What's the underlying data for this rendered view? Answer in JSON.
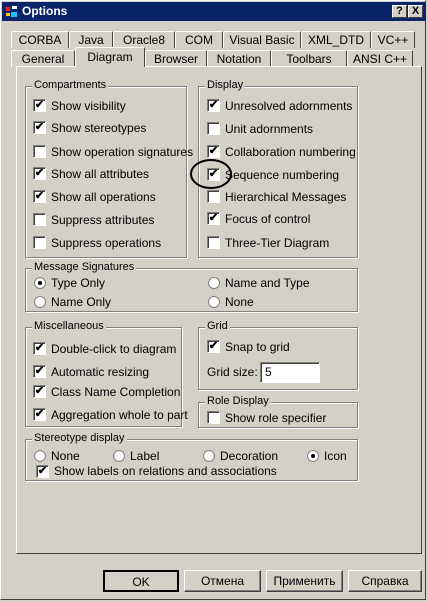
{
  "window": {
    "title": "Options"
  },
  "title_buttons": {
    "help": "?",
    "close": "X"
  },
  "tabs_row1": [
    "CORBA",
    "Java",
    "Oracle8",
    "COM",
    "Visual Basic",
    "XML_DTD",
    "VC++"
  ],
  "tabs_row2": [
    "General",
    "Diagram",
    "Browser",
    "Notation",
    "Toolbars",
    "ANSI C++"
  ],
  "active_tab": "Diagram",
  "compartments": {
    "legend": "Compartments",
    "items": [
      {
        "label": "Show visibility",
        "checked": true
      },
      {
        "label": "Show stereotypes",
        "checked": true
      },
      {
        "label": "Show operation signatures",
        "checked": false
      },
      {
        "label": "Show all attributes",
        "checked": true
      },
      {
        "label": "Show all operations",
        "checked": true
      },
      {
        "label": "Suppress attributes",
        "checked": false
      },
      {
        "label": "Suppress operations",
        "checked": false
      }
    ]
  },
  "display": {
    "legend": "Display",
    "items": [
      {
        "label": "Unresolved adornments",
        "checked": true
      },
      {
        "label": "Unit adornments",
        "checked": false
      },
      {
        "label": "Collaboration numbering",
        "checked": true
      },
      {
        "label": "Sequence numbering",
        "checked": true
      },
      {
        "label": "Hierarchical Messages",
        "checked": false
      },
      {
        "label": "Focus of control",
        "checked": true
      },
      {
        "label": "Three-Tier Diagram",
        "checked": false
      }
    ]
  },
  "message_signatures": {
    "legend": "Message Signatures",
    "options": [
      "Type Only",
      "Name and Type",
      "Name Only",
      "None"
    ],
    "selected": "Type Only"
  },
  "miscellaneous": {
    "legend": "Miscellaneous",
    "items": [
      {
        "label": "Double-click to diagram",
        "checked": true
      },
      {
        "label": "Automatic resizing",
        "checked": true
      },
      {
        "label": "Class Name Completion",
        "checked": true
      },
      {
        "label": "Aggregation whole to part",
        "checked": true
      }
    ]
  },
  "grid": {
    "legend": "Grid",
    "snap_label": "Snap to grid",
    "snap_checked": true,
    "size_label": "Grid size:",
    "size_value": "5"
  },
  "role_display": {
    "legend": "Role Display",
    "label": "Show role specifier",
    "checked": false
  },
  "stereotype_display": {
    "legend": "Stereotype display",
    "options": [
      "None",
      "Label",
      "Decoration",
      "Icon"
    ],
    "selected": "Icon",
    "show_labels": "Show labels on relations and associations",
    "show_labels_checked": true
  },
  "buttons": {
    "ok": "OK",
    "cancel": "Отмена",
    "apply": "Применить",
    "help": "Справка"
  },
  "check_glyph": "✔"
}
